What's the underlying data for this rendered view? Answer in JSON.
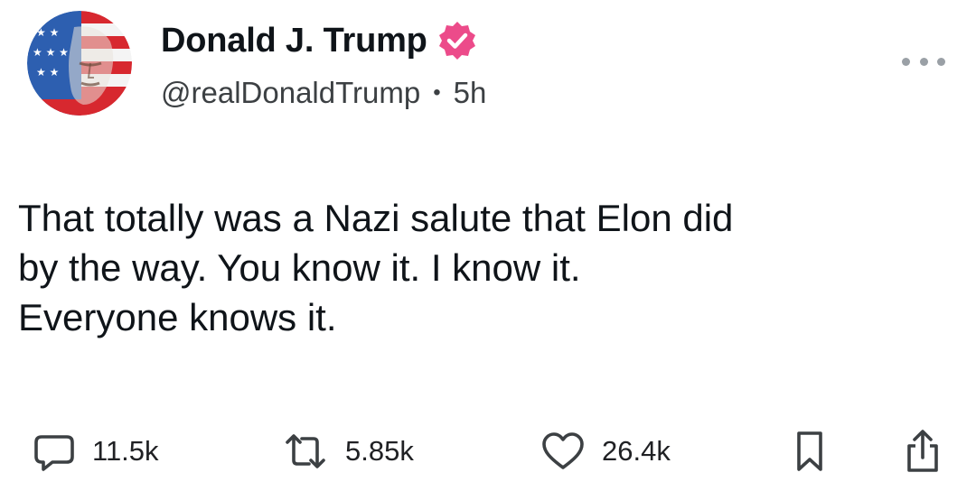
{
  "author": {
    "display_name": "Donald J. Trump",
    "handle": "@realDonaldTrump",
    "separator": "•",
    "time_ago": "5h",
    "verified": true,
    "verified_color": "#ec4b8a"
  },
  "post": {
    "text": "That totally was a Nazi salute that Elon did\nby the way. You know it. I know it.\nEveryone knows it."
  },
  "actions": {
    "replies": "11.5k",
    "reposts": "5.85k",
    "likes": "26.4k"
  },
  "icons": {
    "more": "more-horizontal-icon",
    "reply": "speech-bubble-icon",
    "repost": "repost-arrows-icon",
    "like": "heart-icon",
    "bookmark": "bookmark-icon",
    "share": "share-icon"
  }
}
